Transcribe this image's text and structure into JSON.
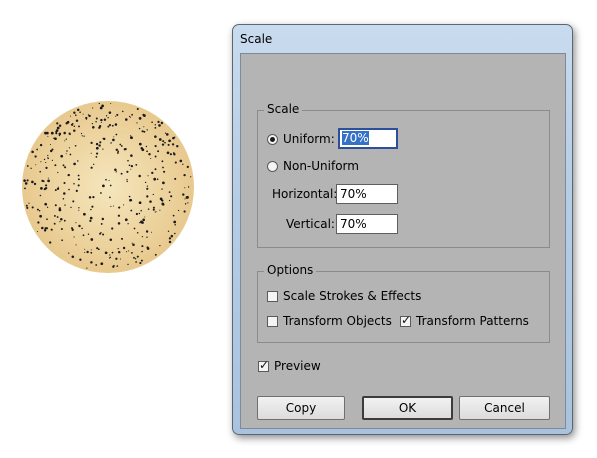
{
  "dialog": {
    "title": "Scale",
    "scale_group": {
      "legend": "Scale",
      "uniform_label": "Uniform:",
      "uniform_value": "70%",
      "uniform_selected": true,
      "non_uniform_label": "Non-Uniform",
      "horizontal_label": "Horizontal:",
      "horizontal_value": "70%",
      "vertical_label": "Vertical:",
      "vertical_value": "70%"
    },
    "options_group": {
      "legend": "Options",
      "scale_strokes_label": "Scale Strokes & Effects",
      "scale_strokes_checked": false,
      "transform_objects_label": "Transform Objects",
      "transform_objects_checked": false,
      "transform_patterns_label": "Transform Patterns",
      "transform_patterns_checked": true
    },
    "preview_label": "Preview",
    "preview_checked": true,
    "buttons": {
      "copy": "Copy",
      "ok": "OK",
      "cancel": "Cancel"
    }
  },
  "canvas": {
    "object": "speckled-circle",
    "fill_center": "#f5e6bd",
    "fill_edge": "#e8c98e",
    "dot_color": "#1a1a1a"
  }
}
